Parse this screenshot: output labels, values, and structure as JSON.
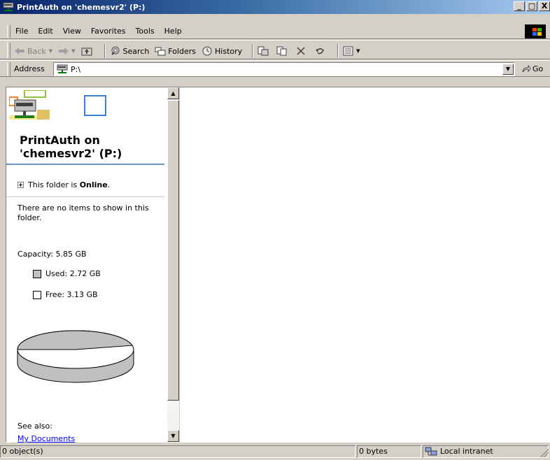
{
  "window": {
    "title": "PrintAuth on 'chemesvr2' (P:)",
    "controls": {
      "minimize": "_",
      "maximize": "□",
      "close": "X"
    }
  },
  "menu": {
    "items": [
      "File",
      "Edit",
      "View",
      "Favorites",
      "Tools",
      "Help"
    ]
  },
  "toolbar": {
    "back_label": "Back",
    "search_label": "Search",
    "folders_label": "Folders",
    "history_label": "History"
  },
  "address": {
    "label": "Address",
    "value": "P:\\",
    "go_label": "Go"
  },
  "leftpane": {
    "folder_title_line1": "PrintAuth on",
    "folder_title_line2": "'chemesvr2' (P:)",
    "online_prefix": "This folder is ",
    "online_status": "Online",
    "online_suffix": ".",
    "no_items": "There are no items to show in this folder.",
    "capacity": "Capacity: 5.85 GB",
    "used": "Used: 2.72 GB",
    "free": "Free: 3.13 GB",
    "see_also": "See also:",
    "see_also_link": "My Documents"
  },
  "disk": {
    "capacity_gb": 5.85,
    "used_gb": 2.72,
    "free_gb": 3.13,
    "used_color": "#c0c0c0",
    "free_color": "#ffffff"
  },
  "status": {
    "objects": "0 object(s)",
    "size": "0 bytes",
    "zone": "Local intranet"
  },
  "colors": {
    "title_gradient_start": "#0a246a",
    "title_gradient_end": "#a6caf0",
    "chrome": "#d4d0c8",
    "rule": "#6b93c8"
  }
}
